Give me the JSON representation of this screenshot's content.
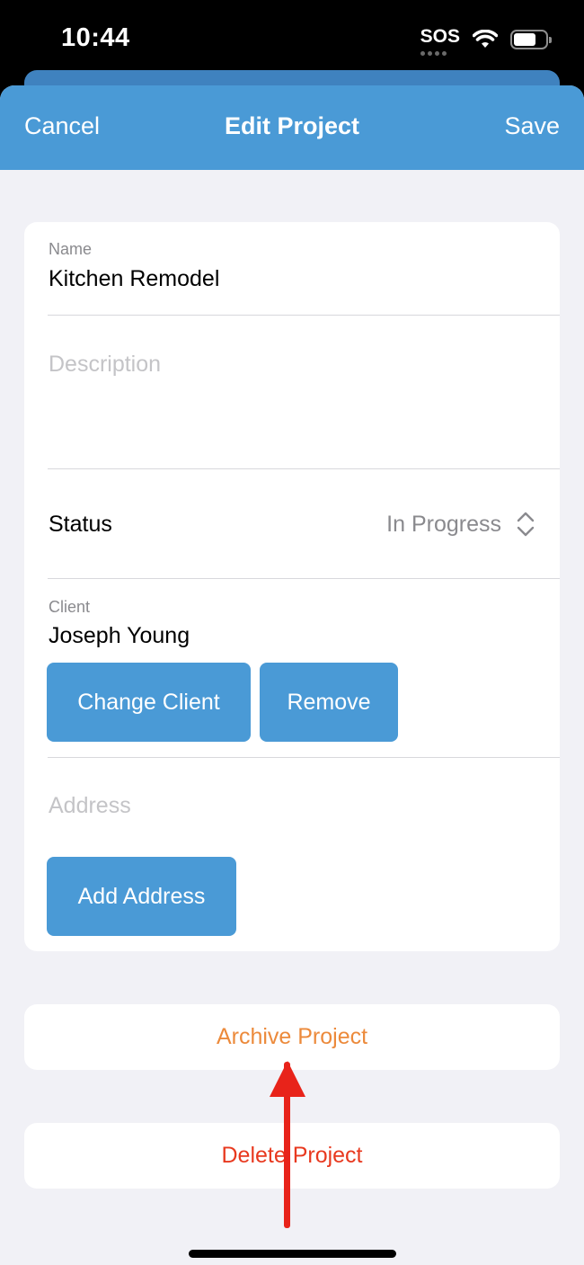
{
  "status_bar": {
    "time": "10:44",
    "sos": "SOS",
    "signal_icon": "wifi-icon",
    "battery_level": 0.7
  },
  "nav": {
    "cancel_label": "Cancel",
    "title": "Edit Project",
    "save_label": "Save",
    "background_color": "#4a9ad6"
  },
  "form": {
    "name_label": "Name",
    "name_value": "Kitchen Remodel",
    "description_placeholder": "Description",
    "status_label": "Status",
    "status_value": "In Progress",
    "client_label": "Client",
    "client_value": "Joseph Young",
    "change_client_label": "Change Client",
    "remove_label": "Remove",
    "address_placeholder": "Address",
    "add_address_label": "Add Address"
  },
  "actions": {
    "archive_label": "Archive Project",
    "archive_color": "#ec8a3b",
    "delete_label": "Delete Project",
    "delete_color": "#e8391f"
  },
  "annotation": {
    "arrow_color": "#e8231a"
  }
}
